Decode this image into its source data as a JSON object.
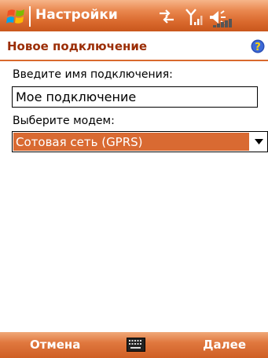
{
  "titlebar": {
    "title": "Настройки",
    "start_icon": "windows-flag-icon",
    "status_icons": [
      "data-connection-icon",
      "signal-strength-icon",
      "volume-icon"
    ]
  },
  "header": {
    "title": "Новое подключение",
    "help_icon": "help-icon"
  },
  "form": {
    "name_label": "Введите имя подключения:",
    "name_value": "Мое подключение",
    "modem_label": "Выберите модем:",
    "modem_value": "Сотовая сеть (GPRS)"
  },
  "softkeys": {
    "left": "Отмена",
    "right": "Далее",
    "center_icon": "keyboard-icon"
  },
  "colors": {
    "accent": "#d9692d",
    "header_text": "#9b2d05",
    "selection": "#d96a32"
  }
}
